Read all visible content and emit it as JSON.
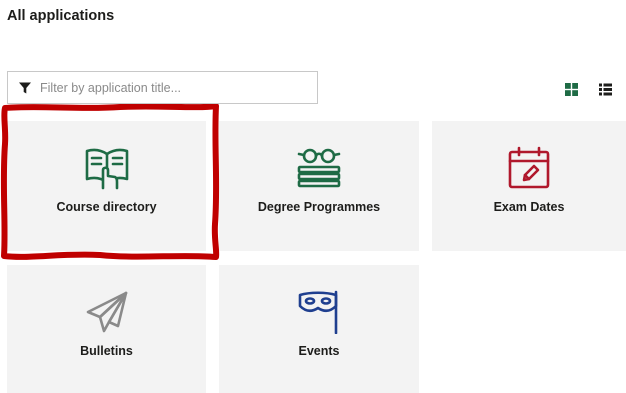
{
  "header": {
    "title": "All applications"
  },
  "filter": {
    "placeholder": "Filter by application title...",
    "value": "",
    "icon": "filter-icon"
  },
  "view": {
    "grid_icon": "grid-view-icon",
    "list_icon": "list-view-icon",
    "active": "grid",
    "accent": "#1e6b45"
  },
  "tiles": [
    {
      "label": "Course directory",
      "icon": "book-reader-icon",
      "color": "#1e6b45"
    },
    {
      "label": "Degree Programmes",
      "icon": "books-glasses-icon",
      "color": "#1e6b45"
    },
    {
      "label": "Exam Dates",
      "icon": "calendar-pen-icon",
      "color": "#b0182c"
    },
    {
      "label": "Bulletins",
      "icon": "paper-plane-icon",
      "color": "#8a8a8a"
    },
    {
      "label": "Events",
      "icon": "mask-flag-icon",
      "color": "#1f3f8f"
    }
  ],
  "highlight_color": "#c00000"
}
